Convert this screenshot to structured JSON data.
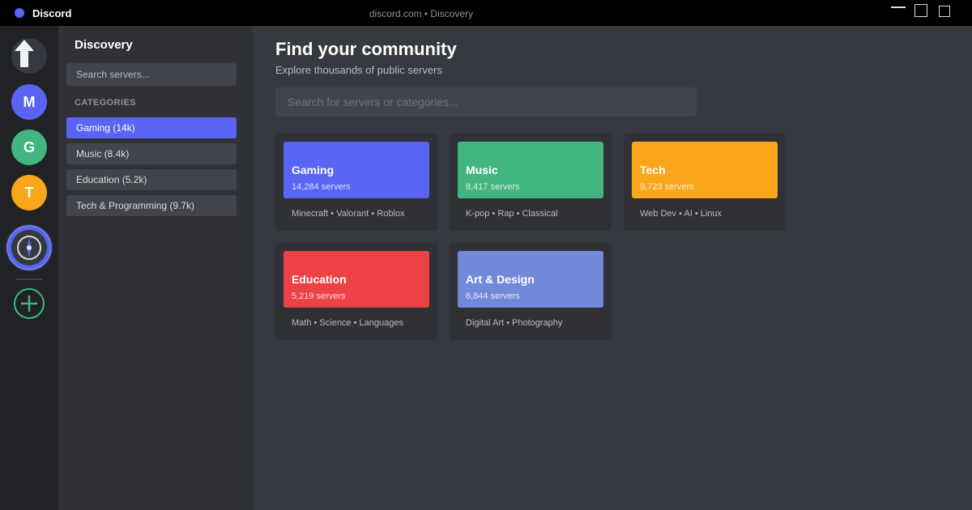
{
  "titlebar": {
    "app_name": "Discord",
    "url": "discord.com • Discovery"
  },
  "rail": {
    "home_icon": "home-arrow-icon",
    "servers": [
      {
        "initial": "M",
        "color": "#5865f2"
      },
      {
        "initial": "G",
        "color": "#43b581"
      },
      {
        "initial": "T",
        "color": "#faa61a"
      }
    ],
    "explore_icon": "compass-icon",
    "add_icon": "plus-circle-icon"
  },
  "sidebar": {
    "title": "Discovery",
    "search_placeholder": "Search servers...",
    "categories_heading": "CATEGORIES",
    "categories": [
      {
        "label": "Gaming (14k)",
        "active": true
      },
      {
        "label": "Music (8.4k)",
        "active": false
      },
      {
        "label": "Education (5.2k)",
        "active": false
      },
      {
        "label": "Tech & Programming (9.7k)",
        "active": false
      }
    ]
  },
  "main": {
    "title": "Find your community",
    "subtitle": "Explore thousands of public servers",
    "search_placeholder": "Search for servers or categories...",
    "cards": [
      {
        "name": "Gaming",
        "count": "14,284 servers",
        "tags": "Minecraft • Valorant • Roblox",
        "color": "#5865f2"
      },
      {
        "name": "Music",
        "count": "8,417 servers",
        "tags": "K-pop • Rap • Classical",
        "color": "#43b581"
      },
      {
        "name": "Tech",
        "count": "9,723 servers",
        "tags": "Web Dev • AI • Linux",
        "color": "#faa61a"
      },
      {
        "name": "Education",
        "count": "5,219 servers",
        "tags": "Math • Science • Languages",
        "color": "#ed4245"
      },
      {
        "name": "Art & Design",
        "count": "6,844 servers",
        "tags": "Digital Art • Photography",
        "color": "#7289da"
      }
    ]
  },
  "colors": {
    "accent": "#5865f2",
    "window_bg": "#36393f",
    "sidebar_bg": "#2f3136",
    "rail_bg": "#202225"
  }
}
